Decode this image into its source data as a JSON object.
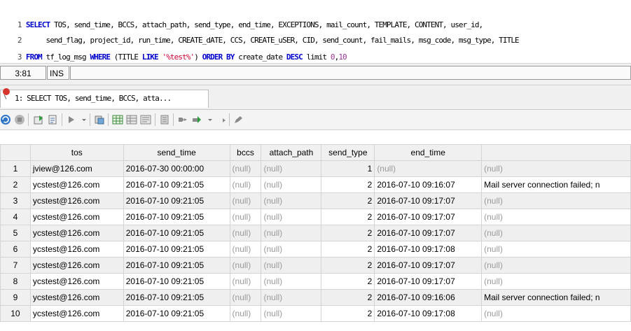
{
  "editor": {
    "lines": [
      {
        "num": "1",
        "parts": [
          {
            "t": "SELECT",
            "c": "kw"
          },
          {
            "t": " TOS, send_time, BCCS, attach_path, send_type, end_time, EXCEPTIONS, mail_count, TEMPLATE, CONTENT, user_id,",
            "c": ""
          }
        ]
      },
      {
        "num": "2",
        "parts": [
          {
            "t": "     send_flag, project_id, run_time, CREATE_dATE, CCS, CREATE_uSER, CID, send_count, fail_mails, msg_code, msg_type, TITLE",
            "c": ""
          }
        ]
      },
      {
        "num": "3",
        "parts": [
          {
            "t": "FROM",
            "c": "kw"
          },
          {
            "t": " tf_log_msg ",
            "c": ""
          },
          {
            "t": "WHERE",
            "c": "kw"
          },
          {
            "t": " (TITLE ",
            "c": ""
          },
          {
            "t": "LIKE",
            "c": "kw"
          },
          {
            "t": " ",
            "c": ""
          },
          {
            "t": "'%test%'",
            "c": "str"
          },
          {
            "t": ") ",
            "c": ""
          },
          {
            "t": "ORDER BY",
            "c": "kw"
          },
          {
            "t": " create_date ",
            "c": ""
          },
          {
            "t": "DESC",
            "c": "kw"
          },
          {
            "t": " limit ",
            "c": ""
          },
          {
            "t": "0",
            "c": "num"
          },
          {
            "t": ",",
            "c": ""
          },
          {
            "t": "10",
            "c": "num"
          }
        ]
      }
    ]
  },
  "status": {
    "cursor": "3:81",
    "mode": "INS"
  },
  "result_tab": {
    "label": "1: SELECT TOS, send_time, BCCS, atta..."
  },
  "toolbar": {
    "icons": [
      "refresh-icon",
      "stop-icon",
      "export-icon",
      "filter-icon",
      "next-page-icon",
      "page-dropdown-icon",
      "copy-icon",
      "grid-view-icon",
      "form-view-icon",
      "text-view-icon",
      "fetch-all-icon",
      "first-record-icon",
      "last-record-icon",
      "nav-dropdown-icon",
      "record-up-icon",
      "edit-icon"
    ]
  },
  "grid": {
    "columns": [
      "",
      "tos",
      "send_time",
      "bccs",
      "attach_path",
      "send_type",
      "end_time",
      ""
    ],
    "rows": [
      [
        "1",
        "jview@126.com",
        "2016-07-30 00:00:00",
        "(null)",
        "(null)",
        "1",
        "(null)",
        "(null)"
      ],
      [
        "2",
        "ycstest@126.com",
        "2016-07-10 09:21:05",
        "(null)",
        "(null)",
        "2",
        "2016-07-10 09:16:07",
        "Mail server connection failed; n"
      ],
      [
        "3",
        "ycstest@126.com",
        "2016-07-10 09:21:05",
        "(null)",
        "(null)",
        "2",
        "2016-07-10 09:17:07",
        "(null)"
      ],
      [
        "4",
        "ycstest@126.com",
        "2016-07-10 09:21:05",
        "(null)",
        "(null)",
        "2",
        "2016-07-10 09:17:07",
        "(null)"
      ],
      [
        "5",
        "ycstest@126.com",
        "2016-07-10 09:21:05",
        "(null)",
        "(null)",
        "2",
        "2016-07-10 09:17:07",
        "(null)"
      ],
      [
        "6",
        "ycstest@126.com",
        "2016-07-10 09:21:05",
        "(null)",
        "(null)",
        "2",
        "2016-07-10 09:17:08",
        "(null)"
      ],
      [
        "7",
        "ycstest@126.com",
        "2016-07-10 09:21:05",
        "(null)",
        "(null)",
        "2",
        "2016-07-10 09:17:07",
        "(null)"
      ],
      [
        "8",
        "ycstest@126.com",
        "2016-07-10 09:21:05",
        "(null)",
        "(null)",
        "2",
        "2016-07-10 09:17:07",
        "(null)"
      ],
      [
        "9",
        "ycstest@126.com",
        "2016-07-10 09:21:05",
        "(null)",
        "(null)",
        "2",
        "2016-07-10 09:16:06",
        "Mail server connection failed; n"
      ],
      [
        "10",
        "ycstest@126.com",
        "2016-07-10 09:21:05",
        "(null)",
        "(null)",
        "2",
        "2016-07-10 09:17:08",
        "(null)"
      ]
    ]
  }
}
